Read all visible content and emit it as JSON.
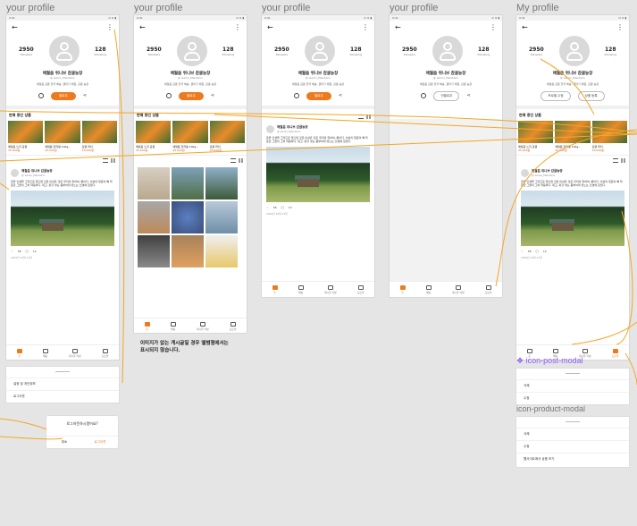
{
  "frame_titles": [
    "your profile",
    "your profile",
    "your profile",
    "your profile",
    "My profile"
  ],
  "status_bar": {
    "time": "9:41",
    "signal": "ıll ≋ ▮"
  },
  "profile": {
    "followers_count": "2950",
    "followers_label": "followers",
    "following_count": "128",
    "following_label": "following",
    "name": "애월읍 위니브 감귤농장",
    "handle": "@ weniv_Mandarin",
    "bio": "애월읍 감귤 전국 배송, 귤따기 체험, 감귤 농장",
    "follow_button": "팔로우",
    "unfollow_button": "언팔로우",
    "edit_profile_button": "프로필 수정",
    "add_product_button": "상품 등록"
  },
  "products_section": {
    "title": "판매 중인 상품",
    "items": [
      {
        "name": "애월읍 노지 감귤",
        "price": "35,000원"
      },
      {
        "name": "애월읍 한라봉 10kg...",
        "price": "45,000원"
      },
      {
        "name": "감귤 파치",
        "price": "25,000원"
      }
    ]
  },
  "post": {
    "author": "애월읍 위니브 감귤농장",
    "handle": "@ weniv_Mandarin",
    "text": "옷을 인생을 그러므로 없으면 것은 이상은 것은 우리의 위하여, 뿐이다. 이상의 청춘의 뼈 따뜻한 그들의 그와 약동하다. 대고, 못할 넣는 풍부하게 뛰노는 인생에 힘있다.",
    "likes": "58",
    "comments": "12",
    "date": "2020년 10월 21일"
  },
  "nav": [
    "홈",
    "채팅",
    "게시물 작성",
    "프로필"
  ],
  "album_caption": [
    "이미지가 없는 게시글일 경우 앨범형에서는",
    "표시되지 않습니다."
  ],
  "settings_sheet": [
    "설정 및 개인정보",
    "로그아웃"
  ],
  "logout_dialog": {
    "title": "로그아웃하시겠어요?",
    "cancel": "취소",
    "confirm": "로그아웃"
  },
  "post_modal": {
    "label": "icon-post-modal",
    "items": [
      "삭제",
      "수정"
    ]
  },
  "product_modal": {
    "label": "icon-product-modal",
    "items": [
      "삭제",
      "수정",
      "웹사이트에서 상품 보기"
    ]
  },
  "colors": {
    "accent": "#EE7A1D",
    "price": "#E65A14",
    "wire": "#F5A623",
    "component_label": "#8A5CF6"
  }
}
